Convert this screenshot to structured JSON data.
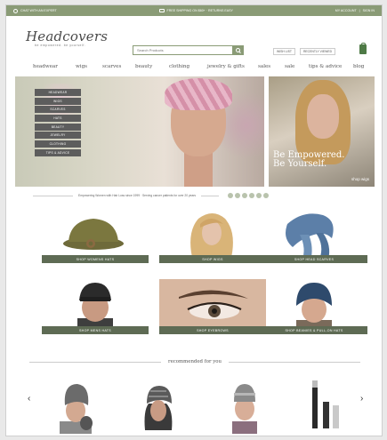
{
  "topbar": {
    "left": "CHAT WITH AN EXPERT",
    "center": "FREE SHIPPING ON $60+ · RETURNS EASY",
    "right1": "MY ACCOUNT",
    "right2": "SIGN IN"
  },
  "logo": {
    "script": "Headcovers",
    "tagline": "be empowered. be yourself."
  },
  "search": {
    "placeholder": "Search Products"
  },
  "account": {
    "wishlist": "WISH LIST",
    "recently": "RECENTLY VIEWED"
  },
  "nav": [
    "headwear",
    "wigs",
    "scarves",
    "beauty",
    "clothing",
    "jewelry & gifts",
    "sales",
    "sale",
    "tips & advice",
    "blog"
  ],
  "hero": {
    "menu": [
      "HEADWEAR",
      "WIGS",
      "SCARVES",
      "HATS",
      "BEAUTY",
      "JEWELRY",
      "CLOTHING",
      "TIPS & ADVICE"
    ],
    "tagline1": "Be Empowered.",
    "tagline2": "Be Yourself.",
    "shop": "shop wigs"
  },
  "strip": {
    "text": "Empowering Women with Hair Loss since 1999 · Serving cancer patients for over 20 years"
  },
  "tiles": [
    {
      "label": "SHOP WOMENS HATS"
    },
    {
      "label": "SHOP WIGS"
    },
    {
      "label": "SHOP HEAD SCARVES"
    },
    {
      "label": "SHOP MENS HATS"
    },
    {
      "label": "SHOP EYEBROWS"
    },
    {
      "label": "SHOP BEANIES & PULL-ON HATS"
    }
  ],
  "recommended": {
    "title": "recommended for you"
  },
  "colors": {
    "brand": "#8a9b76",
    "label": "#5e6b54",
    "accent_dark": "#4e7a46"
  }
}
